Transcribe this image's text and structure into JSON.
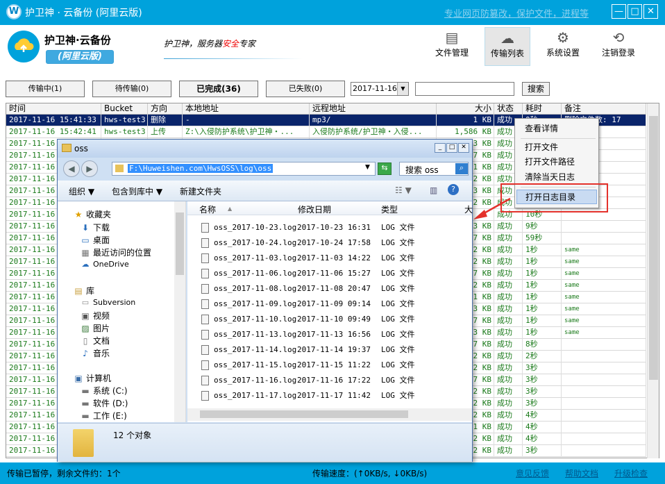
{
  "titlebar": {
    "title": "护卫神 · 云备份 (阿里云版)",
    "slogan": "专业网页防篡改，保护文件，进程等",
    "minimize": "—",
    "maximize": "□",
    "close": "✕"
  },
  "header": {
    "brand": "护卫神·云备份",
    "edition": "(阿里云版)",
    "tagline_a": "护卫神，服务器",
    "tagline_b": "安全",
    "tagline_c": "专家",
    "tools": [
      {
        "label": "文件管理",
        "icon": "file-icon"
      },
      {
        "label": "传输列表",
        "icon": "cloud-upload-icon"
      },
      {
        "label": "系统设置",
        "icon": "gear-icon"
      },
      {
        "label": "注销登录",
        "icon": "logout-icon"
      }
    ]
  },
  "tabs": {
    "transferring": "传输中(1)",
    "waiting": "待传输(0)",
    "done": "已完成(36)",
    "failed": "已失败(0)"
  },
  "filter": {
    "date": "2017-11-16",
    "search_value": "",
    "search_button": "搜索"
  },
  "grid": {
    "columns": [
      "时间",
      "Bucket",
      "方向",
      "本地地址",
      "远程地址",
      "大小",
      "状态",
      "耗时",
      "备注"
    ],
    "rows": [
      {
        "time": "2017-11-16 15:41:33",
        "bucket": "hws-test3",
        "dir": "删除",
        "local": "-",
        "remote": "mp3/",
        "size": "1 KB",
        "status": "成功",
        "cost": "0秒",
        "note": "删除文件数: 17"
      },
      {
        "time": "2017-11-16 15:42:41",
        "bucket": "hws-test3",
        "dir": "上传",
        "local": "Z:\\入侵防护系统\\护卫神・...",
        "remote": "入侵防护系统/护卫神・入侵...",
        "size": "1,586 KB",
        "status": "成功",
        "cost": "",
        "note": ""
      },
      {
        "time": "2017-11-16",
        "size": "3 KB",
        "status": "成功",
        "cost": "",
        "note": ""
      },
      {
        "time": "2017-11-16",
        "size": "7 KB",
        "status": "成功",
        "cost": "",
        "note": ""
      },
      {
        "time": "2017-11-16",
        "size": "1 KB",
        "status": "成功",
        "cost": "",
        "note": ""
      },
      {
        "time": "2017-11-16",
        "size": "2 KB",
        "status": "成功",
        "cost": "",
        "note": ""
      },
      {
        "time": "2017-11-16",
        "size": "3 KB",
        "status": "成功",
        "cost": "",
        "note": ""
      },
      {
        "time": "2017-11-16",
        "size": "2 KB",
        "status": "成功",
        "cost": "",
        "note": ""
      },
      {
        "time": "2017-11-16",
        "size": "",
        "status": "成功",
        "cost": "10秒",
        "note": ""
      },
      {
        "time": "2017-11-16",
        "size": "3 KB",
        "status": "成功",
        "cost": "9秒",
        "note": ""
      },
      {
        "time": "2017-11-16",
        "size": "7 KB",
        "status": "成功",
        "cost": "59秒",
        "note": ""
      },
      {
        "time": "2017-11-16",
        "size": "2 KB",
        "status": "成功",
        "cost": "1秒",
        "note": "same"
      },
      {
        "time": "2017-11-16",
        "size": "2 KB",
        "status": "成功",
        "cost": "1秒",
        "note": "same"
      },
      {
        "time": "2017-11-16",
        "size": "7 KB",
        "status": "成功",
        "cost": "1秒",
        "note": "same"
      },
      {
        "time": "2017-11-16",
        "size": "2 KB",
        "status": "成功",
        "cost": "1秒",
        "note": "same"
      },
      {
        "time": "2017-11-16",
        "size": "1 KB",
        "status": "成功",
        "cost": "1秒",
        "note": "same"
      },
      {
        "time": "2017-11-16",
        "size": "3 KB",
        "status": "成功",
        "cost": "1秒",
        "note": "same"
      },
      {
        "time": "2017-11-16",
        "size": "7 KB",
        "status": "成功",
        "cost": "1秒",
        "note": "same"
      },
      {
        "time": "2017-11-16",
        "size": "3 KB",
        "status": "成功",
        "cost": "1秒",
        "note": "same"
      },
      {
        "time": "2017-11-16",
        "size": "7 KB",
        "status": "成功",
        "cost": "8秒",
        "note": ""
      },
      {
        "time": "2017-11-16",
        "size": "2 KB",
        "status": "成功",
        "cost": "2秒",
        "note": ""
      },
      {
        "time": "2017-11-16",
        "size": "2 KB",
        "status": "成功",
        "cost": "3秒",
        "note": ""
      },
      {
        "time": "2017-11-16",
        "size": "7 KB",
        "status": "成功",
        "cost": "3秒",
        "note": ""
      },
      {
        "time": "2017-11-16",
        "size": "2 KB",
        "status": "成功",
        "cost": "3秒",
        "note": ""
      },
      {
        "time": "2017-11-16",
        "size": "2 KB",
        "status": "成功",
        "cost": "3秒",
        "note": ""
      },
      {
        "time": "2017-11-16",
        "size": "2 KB",
        "status": "成功",
        "cost": "4秒",
        "note": ""
      },
      {
        "time": "2017-11-16",
        "size": "1 KB",
        "status": "成功",
        "cost": "4秒",
        "note": ""
      },
      {
        "time": "2017-11-16",
        "size": "2 KB",
        "status": "成功",
        "cost": "4秒",
        "note": ""
      },
      {
        "time": "2017-11-16",
        "size": "2 KB",
        "status": "成功",
        "cost": "3秒",
        "note": ""
      }
    ]
  },
  "context_menu": {
    "items": [
      "查看详情",
      "打开文件",
      "打开文件路径",
      "清除当天日志",
      "打开日志目录"
    ]
  },
  "explorer": {
    "title": "oss",
    "address": "F:\\Huweishen.com\\HwsOSS\\log\\oss",
    "search_placeholder": "搜索 oss",
    "toolbar": {
      "organize": "组织 ▼",
      "include": "包含到库中 ▼",
      "new_folder": "新建文件夹"
    },
    "nav": {
      "favorites": "收藏夹",
      "downloads": "下载",
      "desktop": "桌面",
      "recent": "最近访问的位置",
      "onedrive": "OneDrive",
      "library": "库",
      "subversion": "Subversion",
      "videos": "视频",
      "pictures": "图片",
      "documents": "文档",
      "music": "音乐",
      "computer": "计算机",
      "drive_c": "系统 (C:)",
      "drive_d": "软件 (D:)",
      "drive_e": "工作 (E:)"
    },
    "columns": {
      "name": "名称",
      "date": "修改日期",
      "type": "类型",
      "size": "大"
    },
    "files": [
      {
        "name": "oss_2017-10-23.log",
        "date": "2017-10-23 16:31",
        "type": "LOG 文件"
      },
      {
        "name": "oss_2017-10-24.log",
        "date": "2017-10-24 17:58",
        "type": "LOG 文件"
      },
      {
        "name": "oss_2017-11-03.log",
        "date": "2017-11-03 14:22",
        "type": "LOG 文件"
      },
      {
        "name": "oss_2017-11-06.log",
        "date": "2017-11-06 15:27",
        "type": "LOG 文件"
      },
      {
        "name": "oss_2017-11-08.log",
        "date": "2017-11-08 20:47",
        "type": "LOG 文件"
      },
      {
        "name": "oss_2017-11-09.log",
        "date": "2017-11-09 09:14",
        "type": "LOG 文件"
      },
      {
        "name": "oss_2017-11-10.log",
        "date": "2017-11-10 09:49",
        "type": "LOG 文件"
      },
      {
        "name": "oss_2017-11-13.log",
        "date": "2017-11-13 16:56",
        "type": "LOG 文件"
      },
      {
        "name": "oss_2017-11-14.log",
        "date": "2017-11-14 19:37",
        "type": "LOG 文件"
      },
      {
        "name": "oss_2017-11-15.log",
        "date": "2017-11-15 11:22",
        "type": "LOG 文件"
      },
      {
        "name": "oss_2017-11-16.log",
        "date": "2017-11-16 17:22",
        "type": "LOG 文件"
      },
      {
        "name": "oss_2017-11-17.log",
        "date": "2017-11-17 11:42",
        "type": "LOG 文件"
      }
    ],
    "status": "12 个对象"
  },
  "statusbar": {
    "left": "传输已暂停，剩余文件约：1个",
    "speed": "传输速度：(↑0KB/s, ↓0KB/s)",
    "feedback": "意见反馈",
    "help": "帮助文档",
    "upgrade": "升级检查"
  }
}
